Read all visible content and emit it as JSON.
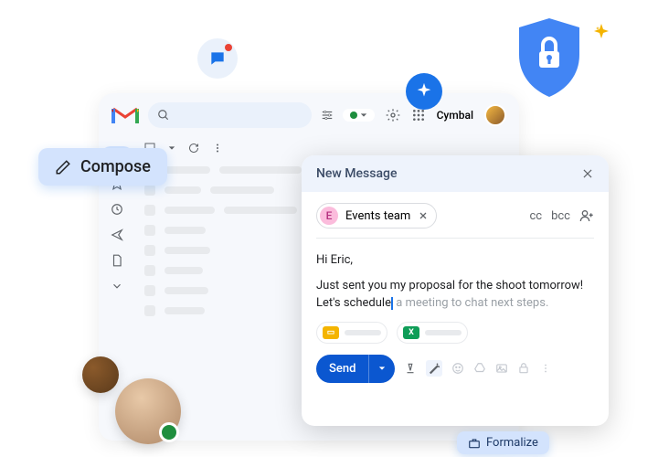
{
  "header": {
    "brand": "Cymbal"
  },
  "compose_button": {
    "label": "Compose"
  },
  "compose": {
    "title": "New Message",
    "recipient": {
      "initial": "E",
      "name": "Events team"
    },
    "cc": "cc",
    "bcc": "bcc",
    "greeting": "Hi Eric,",
    "line1": "Just sent you my proposal for the shoot tomorrow!",
    "line2_typed": "Let's schedule",
    "line2_suggestion": " a meeting to chat next steps.",
    "send_label": "Send"
  },
  "formalize": {
    "label": "Formalize"
  },
  "icons": {
    "shield_color": "#4285f4",
    "slides_color": "#f4b400",
    "sheets_color": "#0f9d58"
  }
}
